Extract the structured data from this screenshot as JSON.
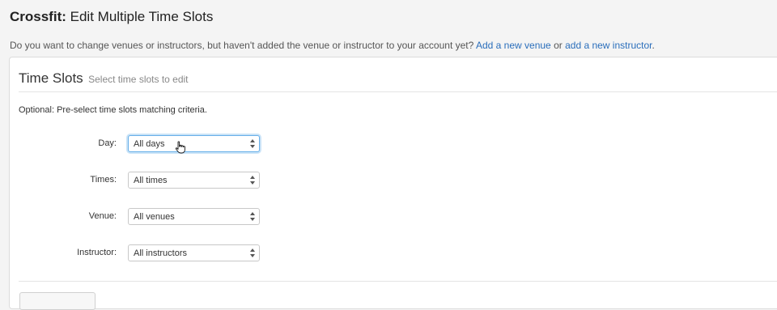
{
  "header": {
    "brand": "Crossfit:",
    "title": "Edit Multiple Time Slots"
  },
  "info": {
    "text": "Do you want to change venues or instructors, but haven't added the venue or instructor to your account yet?",
    "link_venue": "Add a new venue",
    "connector": "or",
    "link_instructor": "add a new instructor",
    "end": "."
  },
  "panel": {
    "title": "Time Slots",
    "hint": "Select time slots to edit",
    "optional_note": "Optional: Pre-select time slots matching criteria."
  },
  "form": {
    "day": {
      "label": "Day:",
      "value": "All days"
    },
    "times": {
      "label": "Times:",
      "value": "All times"
    },
    "venue": {
      "label": "Venue:",
      "value": "All venues"
    },
    "instructor": {
      "label": "Instructor:",
      "value": "All instructors"
    }
  },
  "colors": {
    "link": "#2a6ebb",
    "focus": "#66afe9"
  },
  "icons": {
    "select_arrows": "select-arrows-icon",
    "cursor": "hand-pointer-icon"
  }
}
